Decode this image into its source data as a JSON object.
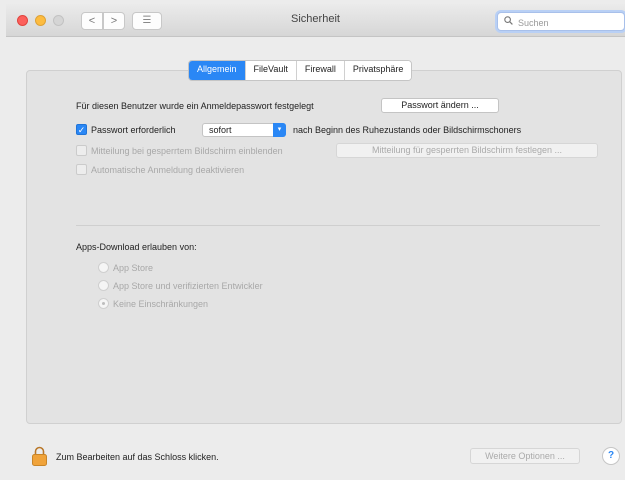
{
  "window": {
    "title": "Sicherheit"
  },
  "toolbar": {
    "back_glyph": "<",
    "forward_glyph": ">",
    "grid_glyph": "☰",
    "search": {
      "placeholder": "Suchen",
      "icon": "search-icon",
      "value": ""
    }
  },
  "tabs": [
    {
      "label": "Allgemein",
      "active": true
    },
    {
      "label": "FileVault",
      "active": false
    },
    {
      "label": "Firewall",
      "active": false
    },
    {
      "label": "Privatsphäre",
      "active": false
    }
  ],
  "general": {
    "password_set_label": "Für diesen Benutzer wurde ein Anmeldepasswort festgelegt",
    "change_password_button": "Passwort ändern ...",
    "require_password": {
      "label": "Passwort erforderlich",
      "checked": true,
      "select_value": "sofort",
      "suffix": "nach Beginn des Ruhezustands oder Bildschirmschoners"
    },
    "lock_message": {
      "label": "Mitteilung bei gesperrtem Bildschirm einblenden",
      "checked": false,
      "enabled": false,
      "button": "Mitteilung für gesperrten Bildschirm festlegen ..."
    },
    "auto_login": {
      "label": "Automatische Anmeldung deaktivieren",
      "checked": false,
      "enabled": false
    }
  },
  "downloads": {
    "heading": "Apps-Download erlauben von:",
    "options": [
      {
        "label": "App Store",
        "selected": false
      },
      {
        "label": "App Store und verifizierten Entwickler",
        "selected": false
      },
      {
        "label": "Keine Einschränkungen",
        "selected": true
      }
    ]
  },
  "footer": {
    "lock_text": "Zum Bearbeiten auf das Schloss klicken.",
    "advanced_button": "Weitere Optionen ...",
    "help_glyph": "?"
  },
  "colors": {
    "accent": "#2a87f5",
    "lock": "#f0a33a"
  }
}
